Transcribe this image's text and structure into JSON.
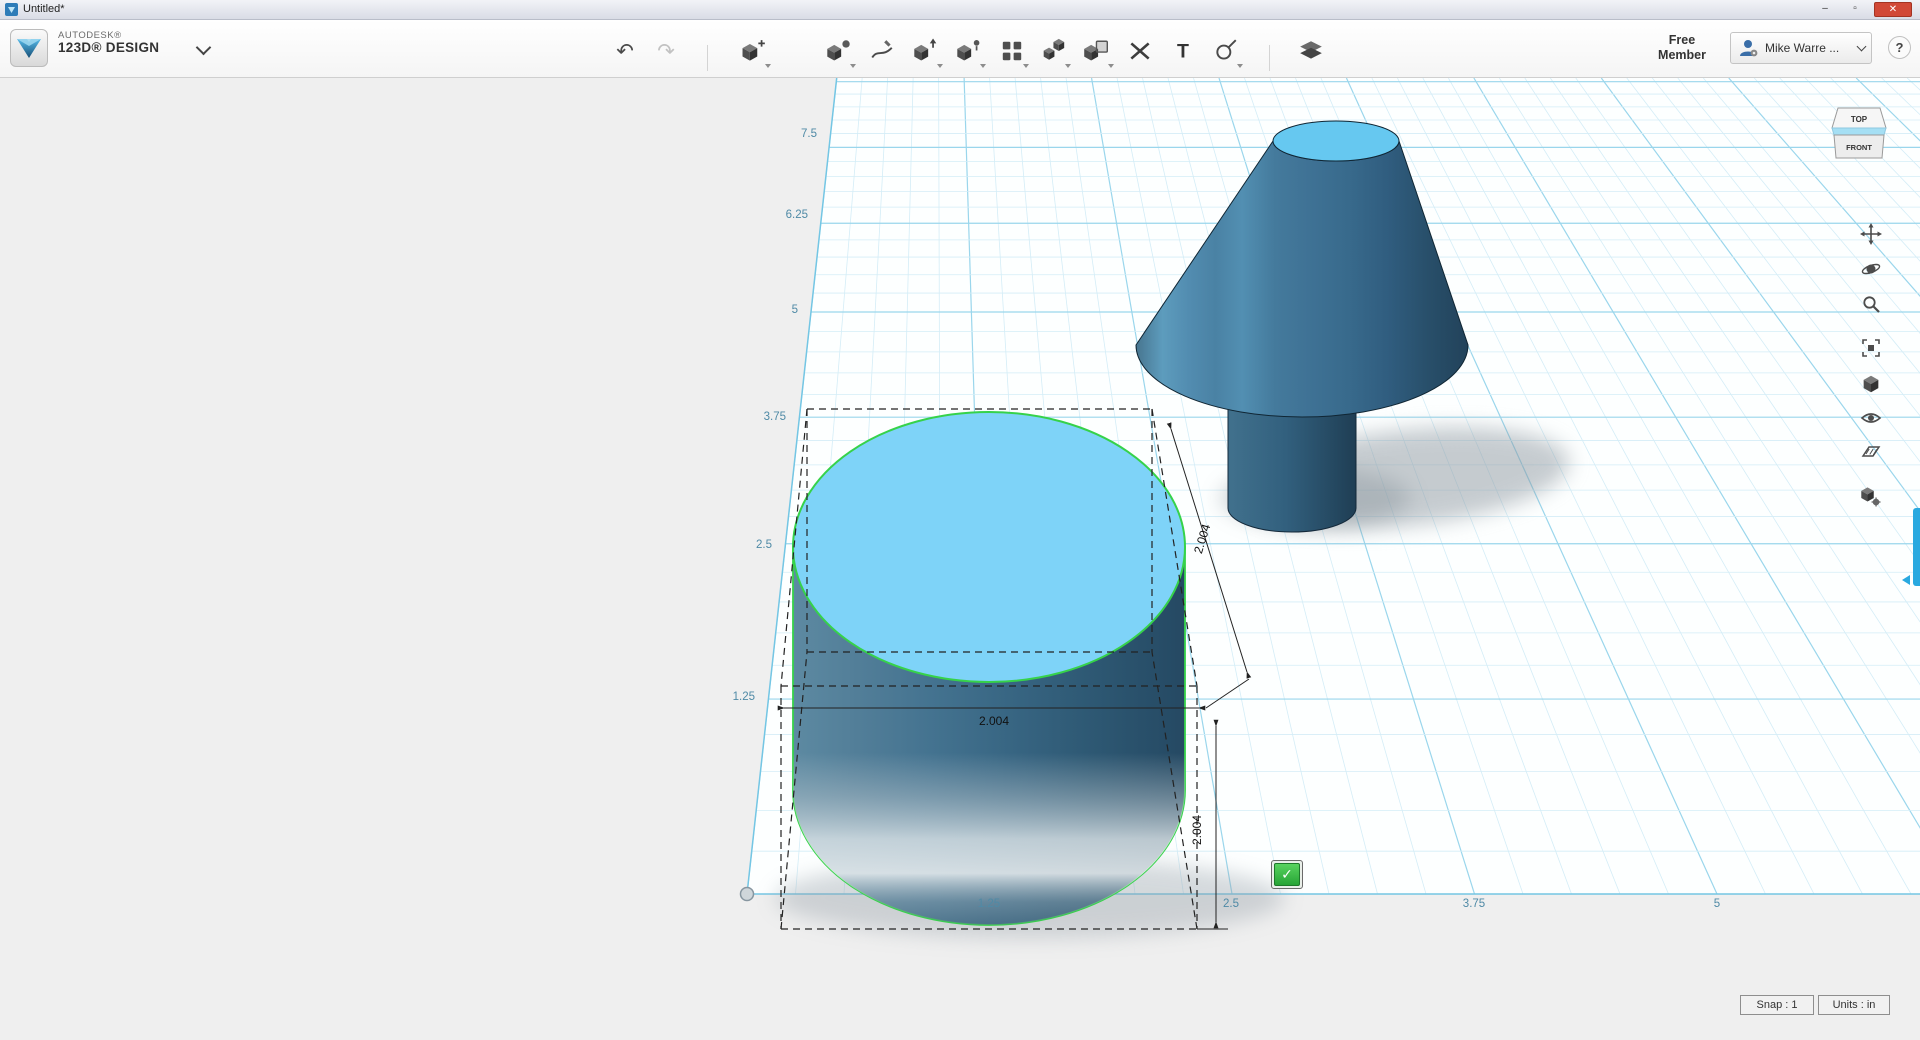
{
  "window": {
    "title": "Untitled*",
    "controls": {
      "minimize": "–",
      "maximize": "▫",
      "close": "✕"
    }
  },
  "brand": {
    "company": "AUTODESK®",
    "product": "123D® DESIGN"
  },
  "toolbar": {
    "undo_glyph": "↶",
    "redo_glyph": "↷",
    "text_tool_glyph": "T",
    "tools": [
      {
        "name": "undo"
      },
      {
        "name": "redo"
      },
      {
        "name": "transform"
      },
      {
        "name": "primitives"
      },
      {
        "name": "sketch"
      },
      {
        "name": "construct"
      },
      {
        "name": "modify"
      },
      {
        "name": "pattern"
      },
      {
        "name": "grouping"
      },
      {
        "name": "combine"
      },
      {
        "name": "measure"
      },
      {
        "name": "text"
      },
      {
        "name": "snap"
      },
      {
        "name": "material"
      }
    ]
  },
  "account": {
    "membership": [
      "Free",
      "Member"
    ],
    "user": "Mike Warre ...",
    "help": "?"
  },
  "viewcube": {
    "top": "TOP",
    "front": "FRONT"
  },
  "grid": {
    "y_labels": [
      "7.5",
      "6.25",
      "5",
      "3.75",
      "2.5",
      "1.25"
    ],
    "x_labels": [
      "1.25",
      "2.5",
      "3.75",
      "5"
    ]
  },
  "selection": {
    "width": "2.004",
    "depth": "2.004",
    "height": "2.004",
    "confirm_glyph": "✓"
  },
  "status": [
    {
      "label": "Snap : 1"
    },
    {
      "label": "Units : in"
    }
  ],
  "colors": {
    "grid_major": "#9ad6ec",
    "grid_minor": "#d4edf7",
    "selection_green": "#36d24a",
    "solid_blue": "#3c7092",
    "solid_top": "#7ed3f8",
    "accent_blue": "#29a9e0"
  }
}
